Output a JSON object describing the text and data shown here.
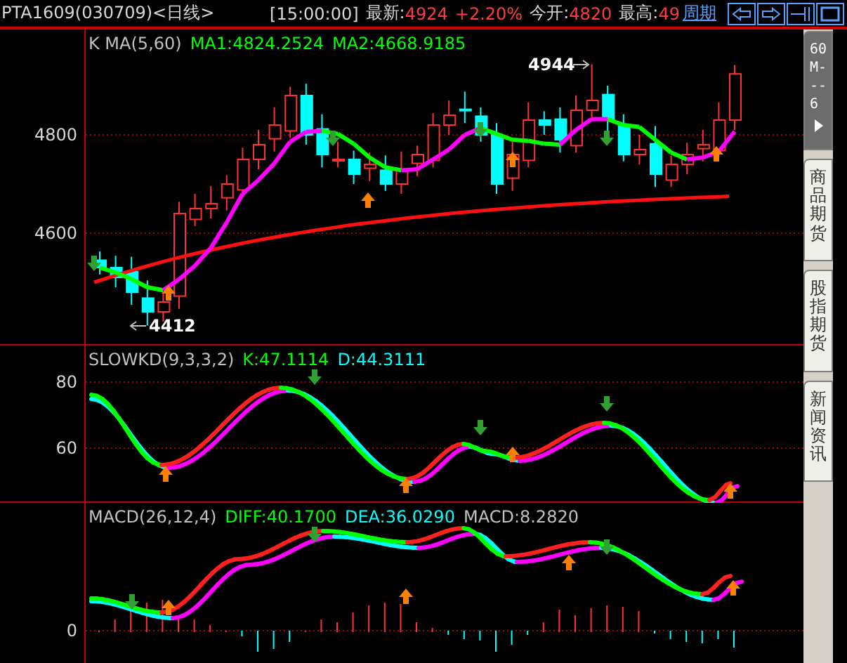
{
  "header": {
    "title": "PTA1609(030709)<日线>",
    "time": "[15:00:00]",
    "latest_label": "最新:",
    "latest_value": "4924",
    "change": "+2.20%",
    "open_label": "今开:",
    "open_value": "4820",
    "high_label": "最高:",
    "high_value": "49",
    "period_link": "周期"
  },
  "main_chart": {
    "legend": [
      {
        "text": "K  MA(5,60)",
        "color": "#c0c0c0"
      },
      {
        "text": "MA1:4824.2524",
        "color": "#00ff00"
      },
      {
        "text": "MA2:4668.9185",
        "color": "#00ff00"
      }
    ],
    "y_labels": [
      "4800",
      "4600"
    ],
    "high_marker": "4944",
    "low_marker": "4412"
  },
  "kd_chart": {
    "legend": [
      {
        "text": "SLOWKD(9,3,3,2)",
        "color": "#c0c0c0"
      },
      {
        "text": "K:47.1114",
        "color": "#00ff00"
      },
      {
        "text": "D:44.3111",
        "color": "#00ffff"
      }
    ],
    "y_labels": [
      "80",
      "60"
    ]
  },
  "macd_chart": {
    "legend": [
      {
        "text": "MACD(26,12,4)",
        "color": "#c0c0c0"
      },
      {
        "text": "DIFF:40.1700",
        "color": "#00ff00"
      },
      {
        "text": "DEA:36.0290",
        "color": "#00ffff"
      },
      {
        "text": "MACD:8.2820",
        "color": "#c0c0c0"
      }
    ],
    "y_labels": [
      "0"
    ]
  },
  "side_tabs": [
    {
      "label": "60M---6",
      "kind": "period",
      "selected": true
    },
    {
      "label": "商品期货",
      "kind": "text",
      "selected": false
    },
    {
      "label": "股指期货",
      "kind": "text",
      "selected": false
    },
    {
      "label": "新闻资讯",
      "kind": "text",
      "selected": false
    }
  ]
}
